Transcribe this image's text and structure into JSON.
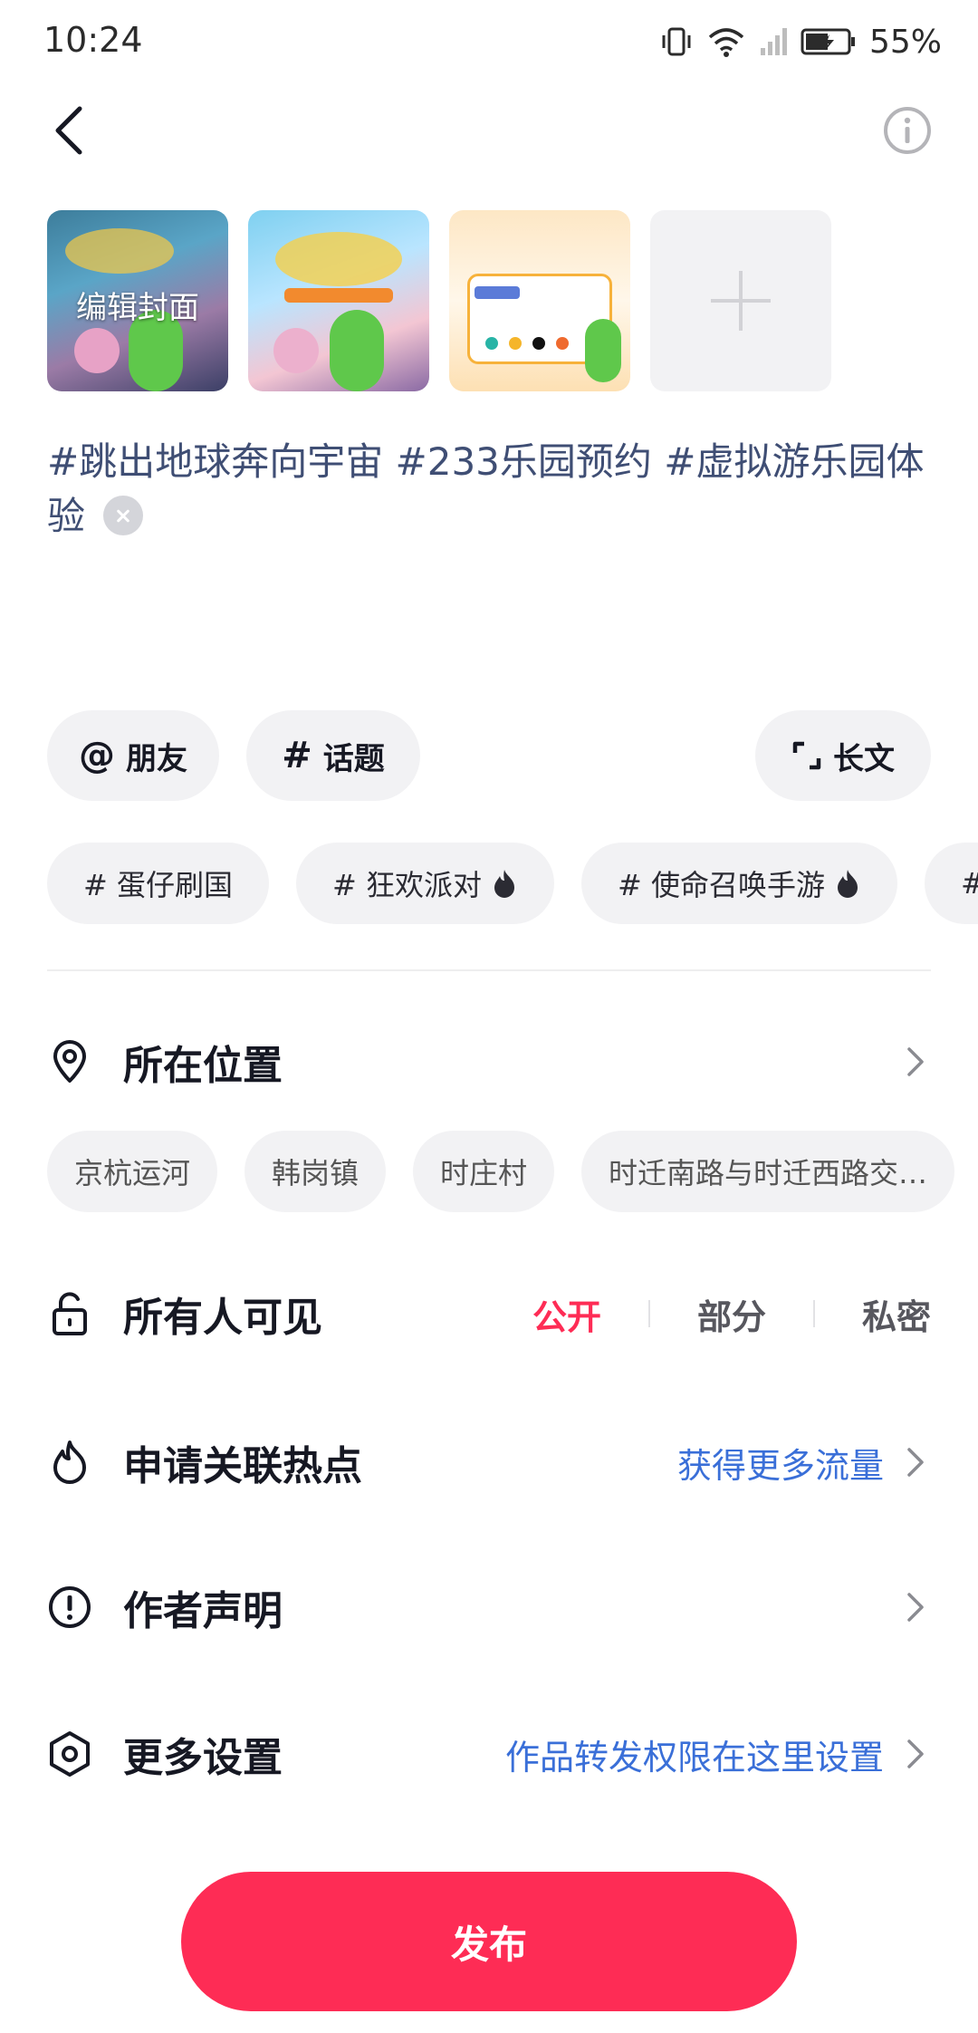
{
  "status_bar": {
    "time": "10:24",
    "battery": "55%"
  },
  "media": {
    "edit_cover_label": "编辑封面"
  },
  "caption": {
    "text": "#跳出地球奔向宇宙 #233乐园预约 #虚拟游乐园体验"
  },
  "actions": {
    "mention_label": "朋友",
    "topic_label": "话题",
    "longform_label": "长文"
  },
  "topics": [
    {
      "label": "# 蛋仔刷国",
      "hot": false
    },
    {
      "label": "# 狂欢派对",
      "hot": true
    },
    {
      "label": "# 使命召唤手游",
      "hot": true
    },
    {
      "label": "#",
      "hot": false
    }
  ],
  "location": {
    "label": "所在位置",
    "suggestions": [
      "京杭运河",
      "韩岗镇",
      "时庄村",
      "时迁南路与时迁西路交…"
    ]
  },
  "visibility": {
    "label": "所有人可见",
    "options": [
      "公开",
      "部分",
      "私密"
    ],
    "selected": "公开"
  },
  "hotspot": {
    "label": "申请关联热点",
    "link": "获得更多流量"
  },
  "author": {
    "label": "作者声明"
  },
  "settings": {
    "label": "更多设置",
    "link": "作品转发权限在这里设置"
  },
  "publish": {
    "label": "发布"
  },
  "colors": {
    "accent": "#fe2c55",
    "link": "#3a6fd8",
    "hashtag": "#3f4e74"
  }
}
